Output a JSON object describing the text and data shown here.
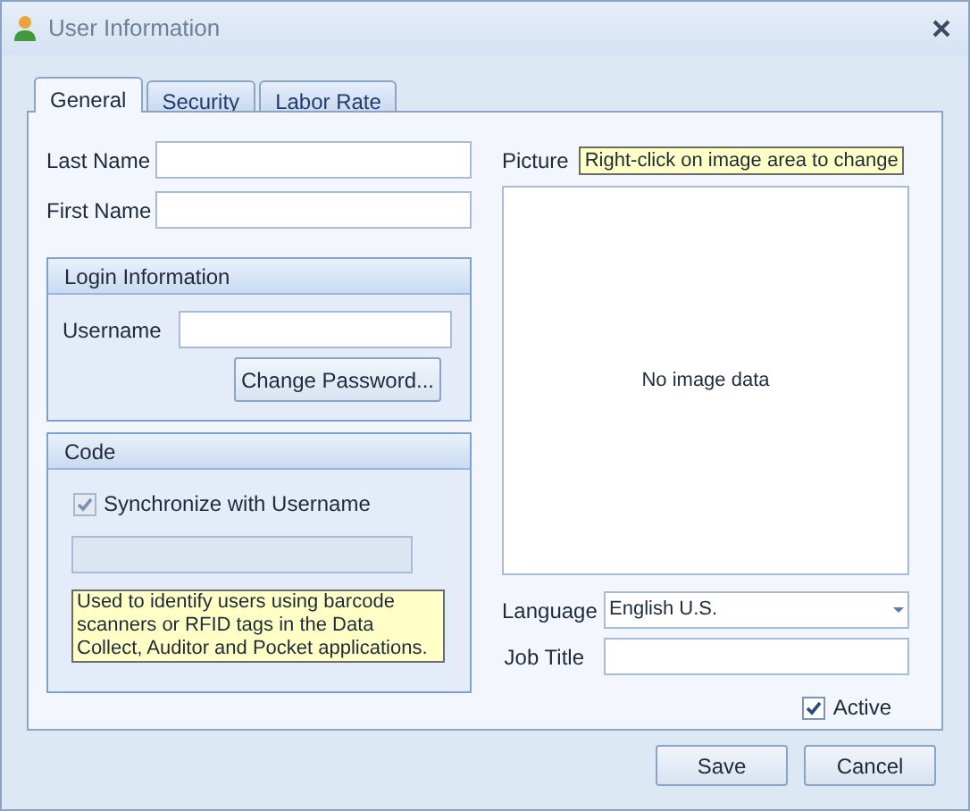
{
  "window": {
    "title": "User Information"
  },
  "tabs": [
    {
      "label": "General",
      "selected": true
    },
    {
      "label": "Security",
      "selected": false
    },
    {
      "label": "Labor Rate",
      "selected": false
    }
  ],
  "last_name": {
    "label": "Last Name"
  },
  "first_name": {
    "label": "First Name"
  },
  "login_group": {
    "title": "Login Information",
    "username_label": "Username",
    "change_password_button": "Change Password..."
  },
  "code_group": {
    "title": "Code",
    "sync_checkbox": {
      "label": "Synchronize with Username",
      "checked": true,
      "disabled": true
    },
    "code_field": {
      "disabled": true
    },
    "hint": "Used to identify users using barcode scanners or RFID tags in the Data Collect, Auditor and Pocket applications."
  },
  "picture": {
    "label": "Picture",
    "tooltip": "Right-click on image area to change",
    "empty_text": "No image data"
  },
  "language": {
    "label": "Language",
    "value": "English U.S."
  },
  "job_title": {
    "label": "Job Title"
  },
  "active": {
    "label": "Active",
    "checked": true
  },
  "buttons": [
    "Save",
    "Cancel"
  ]
}
